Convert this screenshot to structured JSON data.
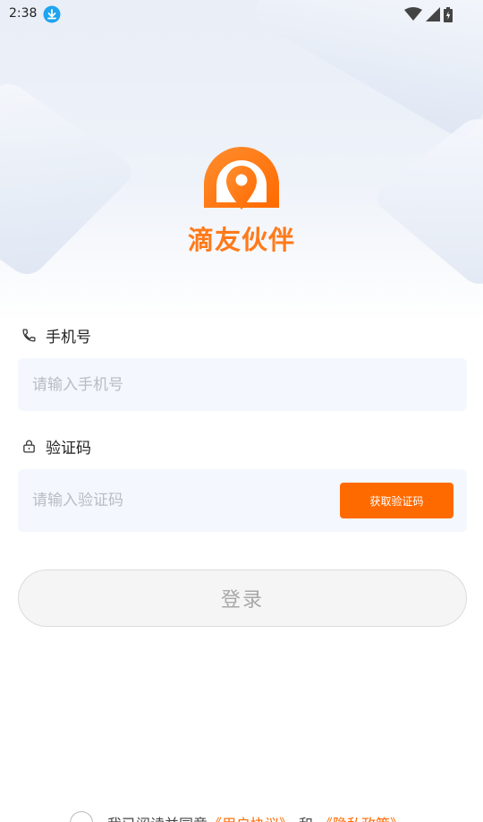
{
  "status_bar": {
    "time": "2:38",
    "icons": [
      "download-icon",
      "wifi-icon",
      "signal-icon",
      "battery-icon"
    ]
  },
  "brand": {
    "name": "滴友伙伴",
    "logo_icon": "location-pin-icon",
    "color": "#ff7a1a"
  },
  "form": {
    "phone": {
      "label": "手机号",
      "icon": "phone-icon",
      "placeholder": "请输入手机号",
      "value": ""
    },
    "code": {
      "label": "验证码",
      "icon": "lock-icon",
      "placeholder": "请输入验证码",
      "value": "",
      "get_code_button": "获取验证码"
    },
    "login_button": "登录"
  },
  "agreement": {
    "prefix": "我已阅读并同意",
    "user_agreement": "《用户协议》",
    "conjunction": "和",
    "privacy_policy": "《隐私政策》",
    "checked": false
  },
  "colors": {
    "accent": "#ff6a00",
    "input_bg": "#f4f7fd",
    "disabled_text": "#a8a8a8"
  }
}
